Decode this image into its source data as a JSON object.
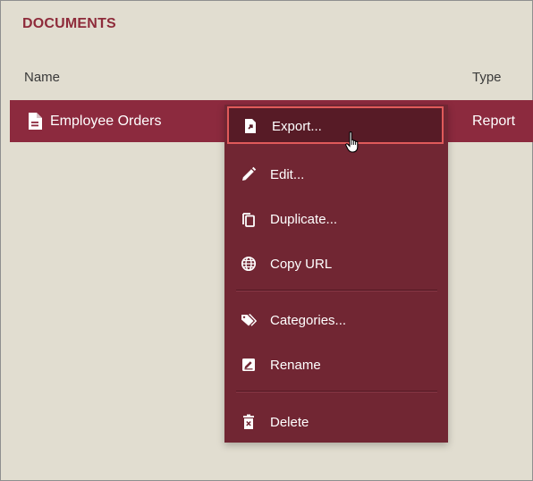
{
  "section": {
    "title": "DOCUMENTS"
  },
  "table": {
    "columns": [
      "Name",
      "Type"
    ],
    "rows": [
      {
        "name": "Employee Orders",
        "type": "Report",
        "icon": "document-icon",
        "selected": true
      }
    ]
  },
  "context_menu": {
    "items": [
      {
        "label": "Export...",
        "icon": "export-file-icon"
      },
      {
        "label": "Edit...",
        "icon": "pencil-icon"
      },
      {
        "label": "Duplicate...",
        "icon": "copy-icon"
      },
      {
        "label": "Copy URL",
        "icon": "globe-icon"
      },
      {
        "label": "Categories...",
        "icon": "tags-icon"
      },
      {
        "label": "Rename",
        "icon": "rename-icon"
      },
      {
        "label": "Delete",
        "icon": "trash-icon"
      }
    ],
    "highlighted_index": 0
  },
  "colors": {
    "background": "#e1ddd0",
    "accent": "#8c2a3e",
    "menu": "#712633",
    "menu_highlight": "#571b26",
    "highlight_border": "#e05a5a"
  }
}
